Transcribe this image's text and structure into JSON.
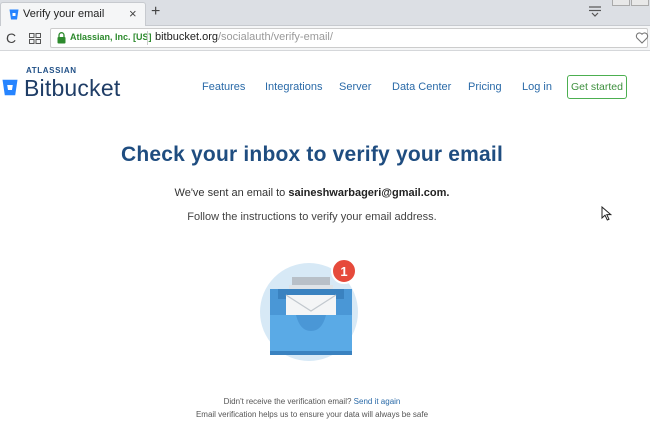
{
  "browser": {
    "tab_title": "Verify your email",
    "tab_close": "×",
    "new_tab": "+",
    "reload": "C",
    "secure_label": "Atlassian, Inc. [US]",
    "url_domain": "bitbucket.org",
    "url_path": "/socialauth/verify-email/"
  },
  "header": {
    "brand_small": "ATLASSIAN",
    "brand": "Bitbucket",
    "nav": {
      "features": "Features",
      "integrations": "Integrations",
      "server": "Server",
      "data_center": "Data Center",
      "pricing": "Pricing",
      "login": "Log in"
    },
    "cta": "Get started"
  },
  "main": {
    "heading": "Check your inbox to verify your email",
    "sent_prefix": "We've sent an email to",
    "email": "saineshwarbageri@gmail.com.",
    "instructions": "Follow the instructions to verify your email address.",
    "badge_count": "1"
  },
  "footer": {
    "question": "Didn't receive the verification email?",
    "resend_link": "Send it again",
    "note": "Email verification helps us to ensure your data will always be safe"
  },
  "colors": {
    "brand_blue": "#1f4d80",
    "link_blue": "#2a6aa8",
    "cta_green": "#4caf50",
    "badge_red": "#e64a3b",
    "secure_green": "#2d8a2d"
  },
  "icons": {
    "tab_favicon": "bitbucket-icon",
    "tab_menu": "tab-list-icon",
    "apps": "grid-icon",
    "lock": "lock-icon",
    "bookmark": "heart-icon",
    "logo": "bitbucket-logo-icon",
    "illustration": "inbox-tray-icon",
    "badge": "notification-badge",
    "cursor": "mouse-cursor-icon"
  }
}
